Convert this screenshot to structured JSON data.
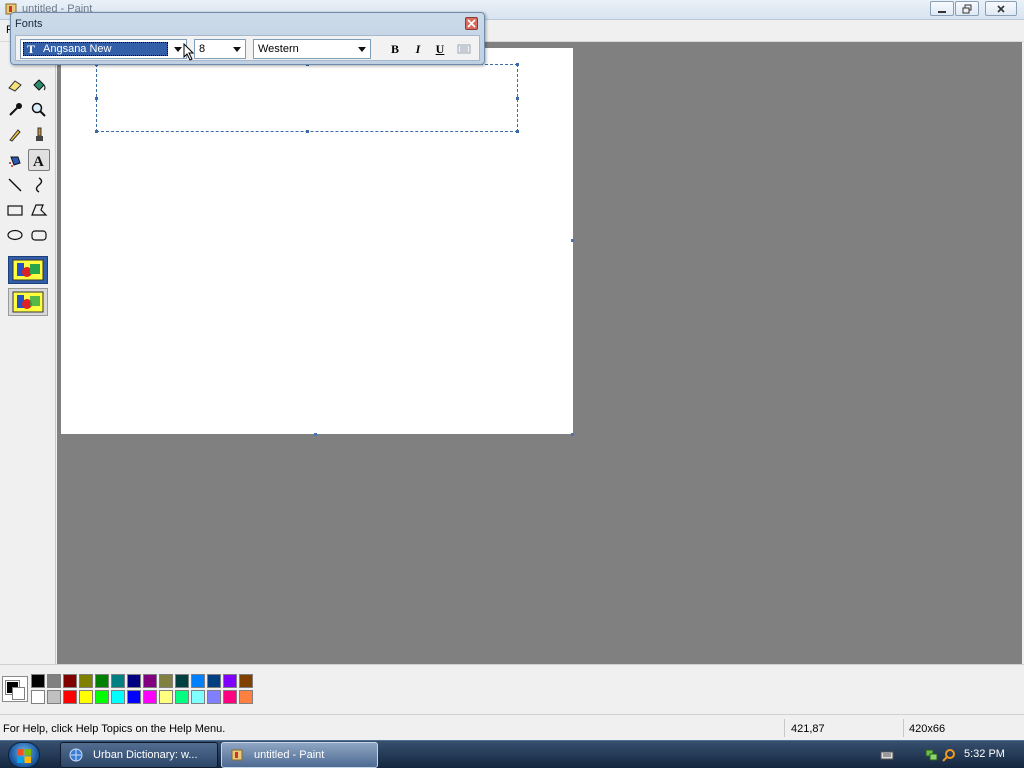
{
  "window": {
    "title": "untitled - Paint",
    "menu_first": "F"
  },
  "fonts_toolbar": {
    "title": "Fonts",
    "font_name": "Angsana New",
    "font_size": "8",
    "script": "Western",
    "bold_label": "B",
    "italic_label": "I",
    "underline_label": "U"
  },
  "toolbox": {
    "tools": [
      "free-form-select",
      "select",
      "eraser",
      "fill",
      "pick-color",
      "magnifier",
      "pencil",
      "brush",
      "airbrush",
      "text",
      "line",
      "curve",
      "rectangle",
      "polygon",
      "ellipse",
      "rounded-rectangle"
    ],
    "active_tool": "text"
  },
  "palette": {
    "foreground": "#000000",
    "background": "#ffffff",
    "top_row": [
      "#000000",
      "#808080",
      "#800000",
      "#808000",
      "#008000",
      "#008080",
      "#000080",
      "#800080",
      "#808040",
      "#004040",
      "#0080ff",
      "#004080",
      "#8000ff",
      "#804000"
    ],
    "bottom_row": [
      "#ffffff",
      "#c0c0c0",
      "#ff0000",
      "#ffff00",
      "#00ff00",
      "#00ffff",
      "#0000ff",
      "#ff00ff",
      "#ffff80",
      "#00ff80",
      "#80ffff",
      "#8080ff",
      "#ff0080",
      "#ff8040"
    ]
  },
  "statusbar": {
    "help_text": "For Help, click Help Topics on the Help Menu.",
    "coordinates": "421,87",
    "selection_size": "420x66"
  },
  "taskbar": {
    "items": [
      {
        "label": "Urban Dictionary: w...",
        "active": false
      },
      {
        "label": "untitled - Paint",
        "active": true
      }
    ],
    "clock": "5:32 PM"
  }
}
